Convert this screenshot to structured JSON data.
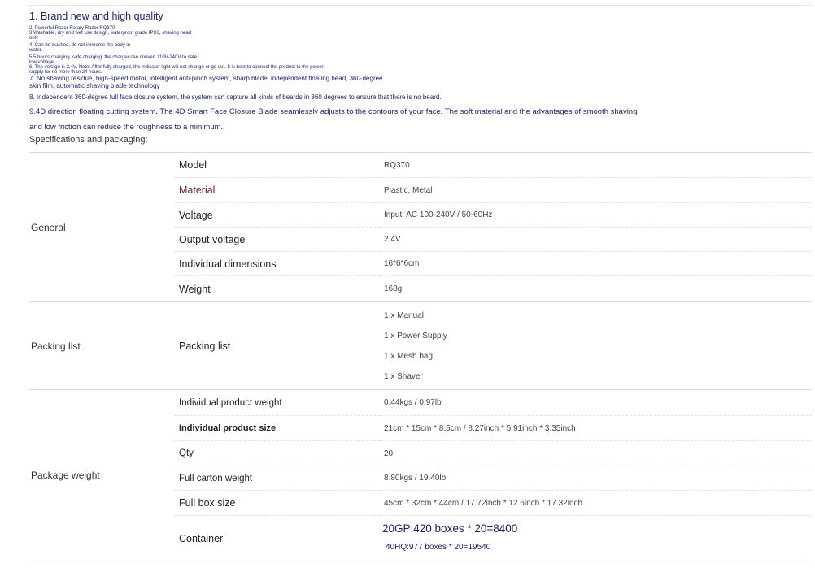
{
  "description": {
    "line1": "1. Brand new and high quality",
    "line2": "2. Powerful Razor Rotary Razor RQ370",
    "line3a": "3 Washable, dry and wet use design, waterproof grade IPX6, shaving head",
    "line3b": "only",
    "line4a": "4. Can be washed, do not immerse the body in",
    "line4b": "water.",
    "line5a": "5.5 hours charging, safe charging, the charger can convert 110V-240V to safe",
    "line5b": "low voltage",
    "line6a": "6. The voltage is 2.4V. Note: After fully charged, the indicator light will not change or go out. It is best to connect the product to the power",
    "line6b": "supply for no more than 24 hours.",
    "line7a": "7. No shaving residue, high-speed motor, intelligent anti-pinch system, sharp blade, independent floating head, 360-degree",
    "line7b": "skin film, automatic shaving blade technology",
    "line8": "8. Independent 360-degree full face closure system, the system can capture all kinds of beards in 360 degrees to ensure that there is no beard.",
    "line9a": "9.4D direction floating cutting system. The 4D Smart Face Closure Blade seamlessly adjusts to the contours of your face. The soft material and the advantages of smooth shaving",
    "line9b": "and low friction can reduce the roughness to a minimum."
  },
  "spec_title": "Specifications and packaging:",
  "general": {
    "group": "General",
    "rows": [
      {
        "label": "Model",
        "value": "RQ370"
      },
      {
        "label": "Material",
        "value": "Plastic, Metal"
      },
      {
        "label": "Voltage",
        "value": "Input: AC 100-240V / 50-60Hz"
      },
      {
        "label": "Output voltage",
        "value": "2.4V"
      },
      {
        "label": "Individual dimensions",
        "value": "16*6*6cm"
      },
      {
        "label": "Weight",
        "value": "168g"
      }
    ]
  },
  "packing": {
    "group": "Packing list",
    "label": "Packing list",
    "items": [
      "1 x Manual",
      "1 x Power Supply",
      "1 x Mesh bag",
      "1 x Shaver"
    ]
  },
  "package": {
    "group": "Package weight",
    "rows": [
      {
        "label": "Individual product weight",
        "value": "0.44kgs / 0.97lb"
      },
      {
        "label": "Individual product size",
        "value": "21cm * 15cm * 8.5cm / 8.27inch * 5.91inch * 3.35inch"
      },
      {
        "label": "Qty",
        "value": "20"
      },
      {
        "label": "Full carton weight",
        "value": "8.80kgs / 19.40lb"
      },
      {
        "label": "Full box size",
        "value": "45cm * 32cm * 44cm / 17.72inch * 12.6inch * 17.32inch"
      }
    ],
    "container_label": "Container",
    "container_20gp": "20GP:420 boxes * 20=8400",
    "container_40hq": "40HQ:977 boxes * 20=19540"
  }
}
